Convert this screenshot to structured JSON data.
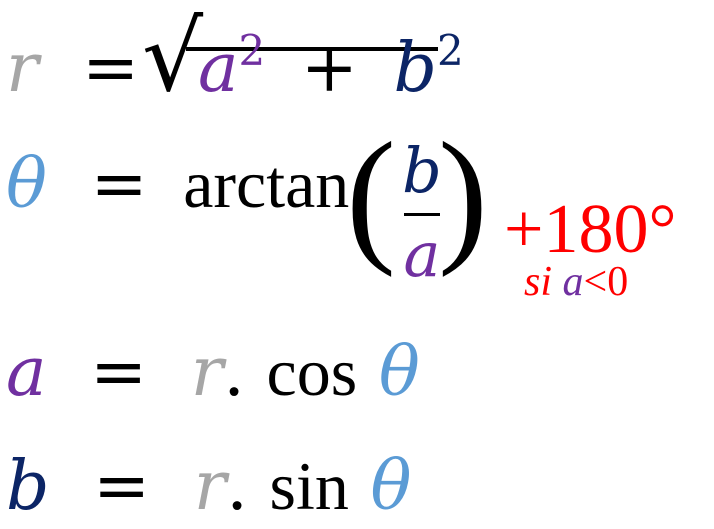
{
  "eq1": {
    "lhs": "r",
    "equals": "=",
    "a": "a",
    "exp_a": "2",
    "plus": "+",
    "b": "b",
    "exp_b": "2",
    "sqrt": "√"
  },
  "eq2": {
    "lhs": "θ",
    "equals": "=",
    "fn": "arctan",
    "lparen": "(",
    "num": "b",
    "den": "a",
    "rparen": ")",
    "adjust": "+180°",
    "cond_si": "si",
    "cond_a": "a",
    "cond_rest": "<0"
  },
  "eq3": {
    "lhs": "a",
    "equals": "=",
    "r": "r",
    "dot": ".",
    "fn": "cos",
    "theta": "θ"
  },
  "eq4": {
    "lhs": "b",
    "equals": "=",
    "r": "r",
    "dot": ".",
    "fn": "sin",
    "theta": "θ"
  },
  "colors": {
    "r": "#a6a6a6",
    "a": "#7030a0",
    "b": "#0c2566",
    "theta": "#5b9bd5",
    "adjust": "#ff0000"
  }
}
